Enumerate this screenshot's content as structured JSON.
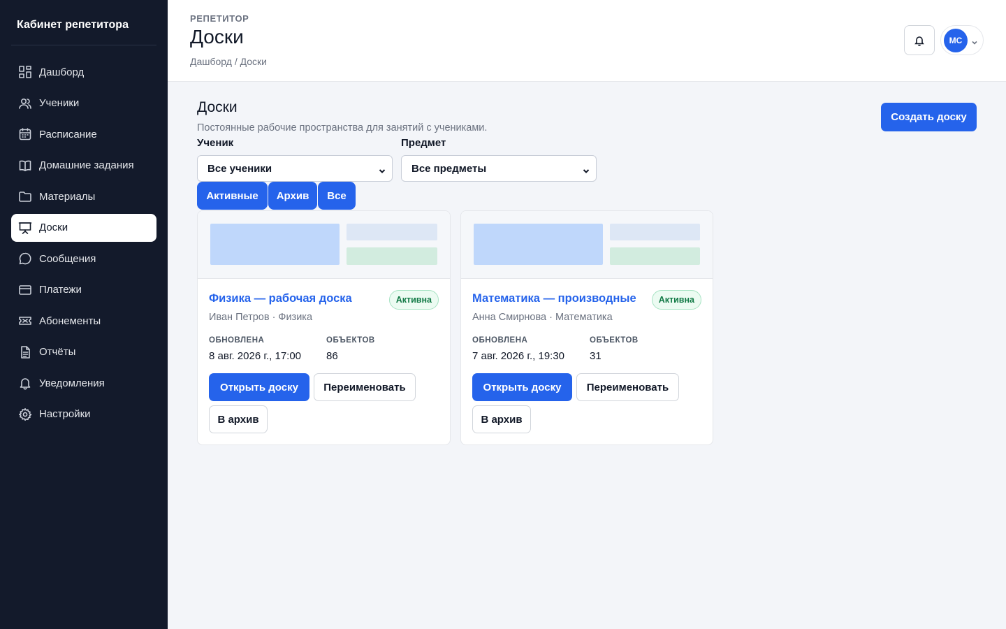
{
  "sidebar": {
    "brand": "Кабинет репетитора",
    "items": [
      {
        "label": "Дашборд",
        "icon": "dashboard-icon"
      },
      {
        "label": "Ученики",
        "icon": "users-icon"
      },
      {
        "label": "Расписание",
        "icon": "calendar-icon"
      },
      {
        "label": "Домашние задания",
        "icon": "book-icon"
      },
      {
        "label": "Материалы",
        "icon": "folder-icon"
      },
      {
        "label": "Доски",
        "icon": "presentation-icon",
        "active": true
      },
      {
        "label": "Сообщения",
        "icon": "message-icon"
      },
      {
        "label": "Платежи",
        "icon": "credit-card-icon"
      },
      {
        "label": "Абонементы",
        "icon": "ticket-icon"
      },
      {
        "label": "Отчёты",
        "icon": "report-icon"
      },
      {
        "label": "Уведомления",
        "icon": "bell-icon"
      },
      {
        "label": "Настройки",
        "icon": "gear-icon"
      }
    ]
  },
  "header": {
    "eyebrow": "РЕПЕТИТОР",
    "title": "Доски",
    "breadcrumb": "Дашборд / Доски",
    "avatar_initials": "МС"
  },
  "main": {
    "section_title": "Доски",
    "section_subtitle": "Постоянные рабочие пространства для занятий с учениками.",
    "create_button": "Создать доску",
    "filters": {
      "student_label": "Ученик",
      "student_value": "Все ученики",
      "subject_label": "Предмет",
      "subject_value": "Все предметы"
    },
    "tabs": [
      "Активные",
      "Архив",
      "Все"
    ],
    "cards": [
      {
        "title": "Физика — рабочая доска",
        "status": "Активна",
        "meta": "Иван Петров · Физика",
        "updated_label": "ОБНОВЛЕНА",
        "updated_value": "8 авг. 2026 г., 17:00",
        "objects_label": "ОБЪЕКТОВ",
        "objects_value": "86",
        "open_label": "Открыть доску",
        "rename_label": "Переименовать",
        "archive_label": "В архив"
      },
      {
        "title": "Математика — производные",
        "status": "Активна",
        "meta": "Анна Смирнова · Математика",
        "updated_label": "ОБНОВЛЕНА",
        "updated_value": "7 авг. 2026 г., 19:30",
        "objects_label": "ОБЪЕКТОВ",
        "objects_value": "31",
        "open_label": "Открыть доску",
        "rename_label": "Переименовать",
        "archive_label": "В архив"
      }
    ]
  },
  "colors": {
    "sidebar_bg": "#131a2b",
    "accent": "#2563eb",
    "status_green": "#127a46"
  }
}
